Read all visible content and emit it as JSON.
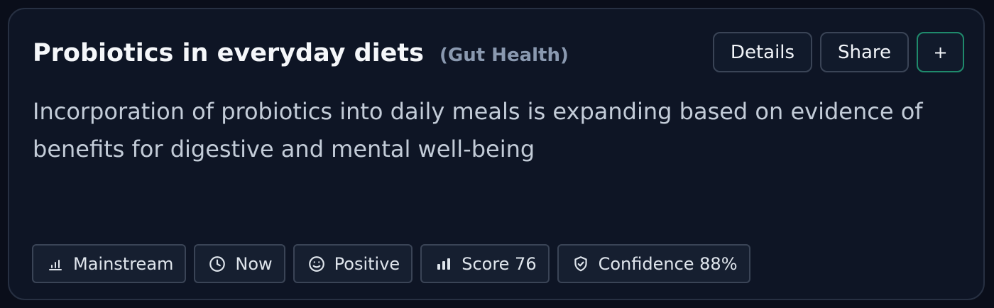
{
  "card": {
    "title": "Probiotics in everyday diets",
    "category": "(Gut Health)",
    "description": "Incorporation of probiotics into daily meals is expanding based on evidence of benefits for digestive and mental well-being",
    "actions": {
      "details_label": "Details",
      "share_label": "Share",
      "add_label": "+"
    },
    "tags": [
      {
        "label": "Mainstream",
        "icon": "bar-chart-icon"
      },
      {
        "label": "Now",
        "icon": "clock-icon"
      },
      {
        "label": "Positive",
        "icon": "smile-icon"
      },
      {
        "label": "Score 76",
        "icon": "signal-bars-icon"
      },
      {
        "label": "Confidence 88%",
        "icon": "shield-check-icon"
      }
    ]
  },
  "colors": {
    "background": "#0a0e1a",
    "card_background": "#0e1525",
    "border": "#273042",
    "accent": "#1f8a6c",
    "muted": "#8a99b0"
  }
}
